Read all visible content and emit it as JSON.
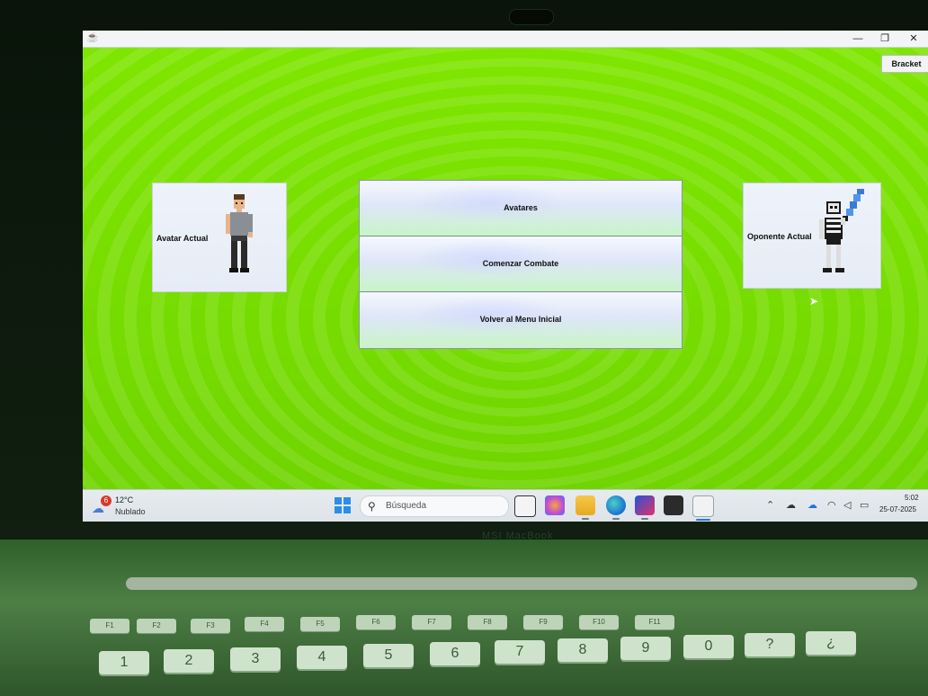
{
  "window": {
    "title": "",
    "controls": [
      "—",
      "❐",
      "✕"
    ],
    "bracket_label": "Bracket"
  },
  "avatar_card": {
    "label": "Avatar Actual",
    "image": "pixel-man-sprite"
  },
  "opponent_card": {
    "label": "Oponente Actual",
    "image": "pixel-skeleton-sword-sprite"
  },
  "menu": {
    "avatars_label": "Avatares",
    "start_combat_label": "Comenzar Combate",
    "back_label": "Volver al Menu Inicial"
  },
  "taskbar": {
    "weather_badge": "6",
    "weather_temp": "12°C",
    "weather_condition": "Nublado",
    "search_placeholder": "Búsqueda",
    "apps": [
      "task-view",
      "copilot",
      "file-explorer",
      "edge",
      "intellij",
      "terminal",
      "java-app"
    ],
    "clock_time": "5:02",
    "clock_date": "25-07-2025"
  },
  "colors": {
    "app_background": "#7ce000",
    "titlebar": "#f2f4f6",
    "card": "#eef3fb",
    "taskbar": "#e6ebef"
  },
  "laptop": {
    "brand": "MSI MacBook",
    "function_keys": [
      "F1",
      "F2",
      "F3",
      "F4",
      "F5",
      "F6",
      "F7",
      "F8",
      "F9",
      "F10",
      "F11"
    ],
    "number_keys": [
      "1",
      "2",
      "3",
      "4",
      "5",
      "6",
      "7",
      "8",
      "9",
      "0",
      "?",
      "¿"
    ]
  }
}
